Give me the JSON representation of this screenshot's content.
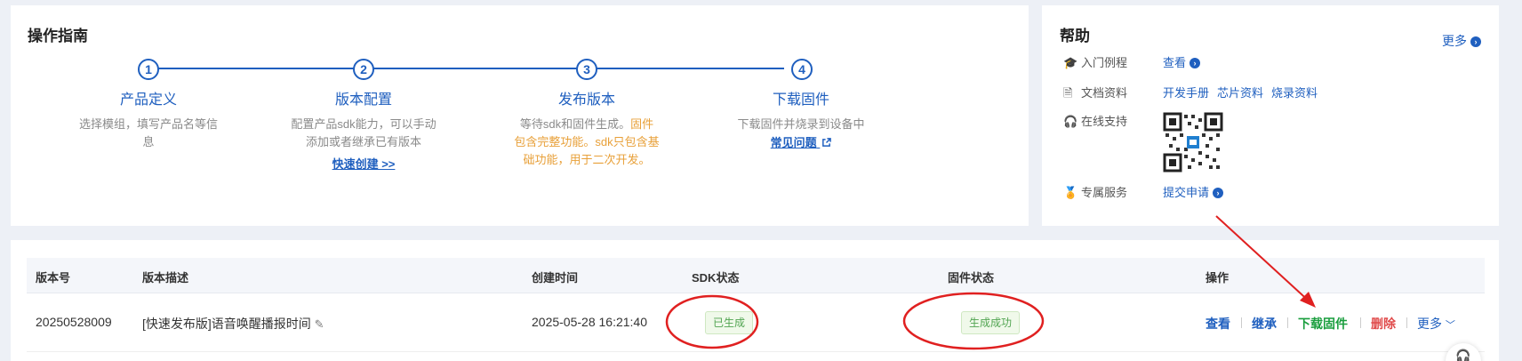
{
  "guide": {
    "title": "操作指南",
    "steps": [
      {
        "num": "1",
        "title": "产品定义",
        "desc_lines": [
          "选择模组，填写产品名等信",
          "息"
        ]
      },
      {
        "num": "2",
        "title": "版本配置",
        "desc_lines": [
          "配置产品sdk能力，可以手动",
          "添加或者继承已有版本"
        ],
        "link": "快速创建 >>"
      },
      {
        "num": "3",
        "title": "发布版本",
        "desc_plain": "等待sdk和固件生成。",
        "desc_warn_1": "固件",
        "desc_warn_2": "包含完整功能。sdk只包含基",
        "desc_warn_3": "础功能，用于二次开发。"
      },
      {
        "num": "4",
        "title": "下载固件",
        "desc_lines": [
          "下载固件并烧录到设备中"
        ],
        "link": "常见问题"
      }
    ]
  },
  "help": {
    "title": "帮助",
    "more": "更多",
    "rows": [
      {
        "icon": "graduation-cap-icon",
        "label": "入门例程",
        "links": [
          "查看"
        ]
      },
      {
        "icon": "document-icon",
        "label": "文档资料",
        "links": [
          "开发手册",
          "芯片资料",
          "烧录资料"
        ]
      },
      {
        "icon": "headset-icon",
        "label": "在线支持"
      },
      {
        "icon": "medal-icon",
        "label": "专属服务",
        "links": [
          "提交申请"
        ]
      }
    ]
  },
  "table": {
    "headers": [
      "版本号",
      "版本描述",
      "创建时间",
      "SDK状态",
      "固件状态",
      "操作"
    ],
    "rows": [
      {
        "version": "20250528009",
        "description": "[快速发布版]语音唤醒播报时间",
        "created": "2025-05-28 16:21:40",
        "sdk_status": "已生成",
        "firmware_status": "生成成功",
        "actions": {
          "view": "查看",
          "inherit": "继承",
          "download": "下载固件",
          "delete": "删除",
          "more": "更多"
        }
      }
    ]
  },
  "colors": {
    "accent": "#1f5fbf",
    "warn": "#e8a039",
    "success": "#1a9e3e",
    "danger": "#e04b4b",
    "annotation": "#e02020"
  }
}
